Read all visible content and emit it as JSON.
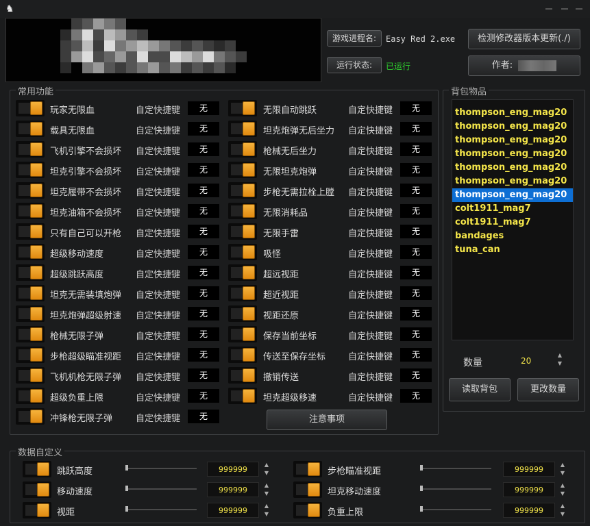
{
  "window": {
    "icon": "app-logo-icon"
  },
  "header": {
    "process_button": "游戏进程名:",
    "process_value": "Easy Red 2.exe",
    "status_button": "运行状态:",
    "status_value": "已运行",
    "status_color": "#2ecc2e",
    "check_update_button": "检测修改器版本更新(./)",
    "author_button": "作者:"
  },
  "features": {
    "title": "常用功能",
    "hotkey_label": "自定快捷键",
    "hotkey_value": "无",
    "left": [
      "玩家无限血",
      "载具无限血",
      "飞机引擎不会损坏",
      "坦克引擎不会损坏",
      "坦克履带不会损坏",
      "坦克油箱不会损坏",
      "只有自己可以开枪",
      "超级移动速度",
      "超级跳跃高度",
      "坦克无需装填炮弹",
      "坦克炮弹超级射速",
      "枪械无限子弹",
      "步枪超级瞄准视距",
      "飞机机枪无限子弹",
      "超级负重上限",
      "冲锋枪无限子弹"
    ],
    "right": [
      "无限自动跳跃",
      "坦克炮弹无后坐力",
      "枪械无后坐力",
      "无限坦克炮弹",
      "步枪无需拉栓上膛",
      "无限消耗品",
      "无限手雷",
      "吸怪",
      "超远视距",
      "超近视距",
      "视距还原",
      "保存当前坐标",
      "传送至保存坐标",
      "撤销传送",
      "坦克超级移速"
    ],
    "notice_button": "注意事项"
  },
  "inventory": {
    "title": "背包物品",
    "items": [
      "thompson_eng_mag20",
      "thompson_eng_mag20",
      "thompson_eng_mag20",
      "thompson_eng_mag20",
      "thompson_eng_mag20",
      "thompson_eng_mag20",
      "thompson_eng_mag20",
      "colt1911_mag7",
      "colt1911_mag7",
      "bandages",
      "tuna_can"
    ],
    "selected_index": 6,
    "quantity_label": "数量",
    "quantity_value": "20",
    "read_button": "读取背包",
    "change_button": "更改数量"
  },
  "custom": {
    "title": "数据自定义",
    "left": [
      {
        "label": "跳跃高度",
        "value": "999999"
      },
      {
        "label": "移动速度",
        "value": "999999"
      },
      {
        "label": "视距",
        "value": "999999"
      }
    ],
    "right": [
      {
        "label": "步枪瞄准视距",
        "value": "999999"
      },
      {
        "label": "坦克移动速度",
        "value": "999999"
      },
      {
        "label": "负重上限",
        "value": "999999"
      }
    ]
  },
  "colors": {
    "accent_orange": "#f0a020",
    "list_text": "#f5e64a",
    "selection_blue": "#0e6fd4"
  }
}
